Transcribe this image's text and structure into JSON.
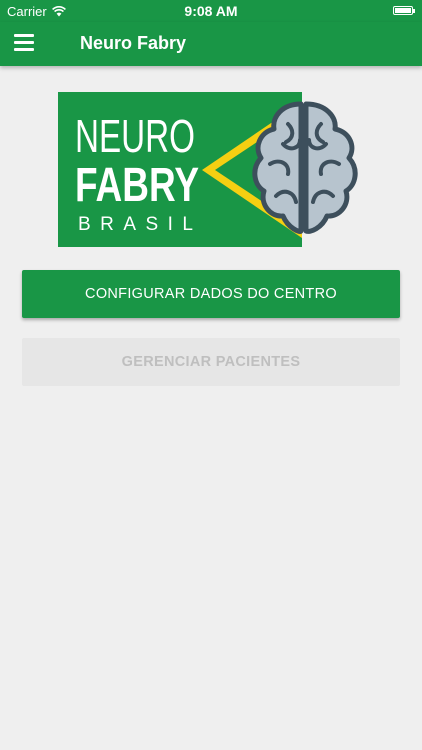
{
  "status_bar": {
    "carrier": "Carrier",
    "time": "9:08 AM"
  },
  "app_bar": {
    "title": "Neuro Fabry"
  },
  "logo": {
    "line1": "NEURO",
    "line2": "FABRY",
    "line3": "BRASIL"
  },
  "actions": {
    "configure_label": "CONFIGURAR DADOS DO CENTRO",
    "manage_label": "GERENCIAR PACIENTES"
  },
  "colors": {
    "brand_green": "#199646",
    "flag_yellow": "#f5cf12",
    "brain_fill": "#b7c4ce",
    "brain_outline": "#3d4f5c",
    "background": "#efefef"
  }
}
